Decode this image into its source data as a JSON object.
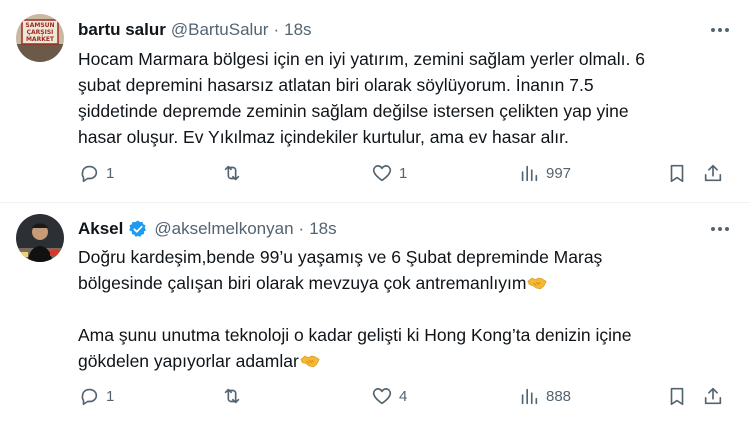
{
  "tweets": [
    {
      "display_name": "bartu salur",
      "handle": "@BartuSalur",
      "separator": "·",
      "time": "18s",
      "text_lines": [
        "Hocam Marmara bölgesi için en iyi yatırım, zemini sağlam yerler olmalı. 6",
        "şubat depremini hasarsız atlatan biri olarak söylüyorum. İnanın 7.5",
        "şiddetinde depremde zeminin sağlam değilse istersen çelikten yap yine",
        "hasar oluşur. Ev Yıkılmaz içindekiler kurtulur, ama ev hasar alır."
      ],
      "replies": "1",
      "retweets": "",
      "likes": "1",
      "views": "997",
      "avatar_sign_lines": [
        "SAMSUN",
        "ÇARŞISI",
        "MARKET"
      ]
    },
    {
      "display_name": "Aksel",
      "handle": "@akselmelkonyan",
      "separator": "·",
      "time": "18s",
      "text_lines": [
        "Doğru kardeşim,bende 99’u yaşamış ve 6 Şubat depreminde Maraş",
        "bölgesinde  çalışan biri olarak mevzuya çok antremanlıyım",
        "",
        "Ama şunu unutma teknoloji o kadar gelişti ki Hong Kong’ta denizin içine",
        "gökdelen yapıyorlar adamlar"
      ],
      "replies": "1",
      "retweets": "",
      "likes": "4",
      "views": "888",
      "verified": true
    }
  ],
  "icons": {
    "more": "more-horizontal-icon",
    "reply": "reply-bubble-icon",
    "retweet": "retweet-icon",
    "like": "heart-icon",
    "views": "views-bar-chart-icon",
    "bookmark": "bookmark-icon",
    "share": "share-upload-icon",
    "emoji": "handshake-emoji-icon",
    "verified": "verified-badge-icon"
  },
  "colors": {
    "text": "#0f1419",
    "secondary": "#536471",
    "verified": "#1d9bf0",
    "divider": "#eff3f4",
    "emoji": "#f5b931"
  }
}
